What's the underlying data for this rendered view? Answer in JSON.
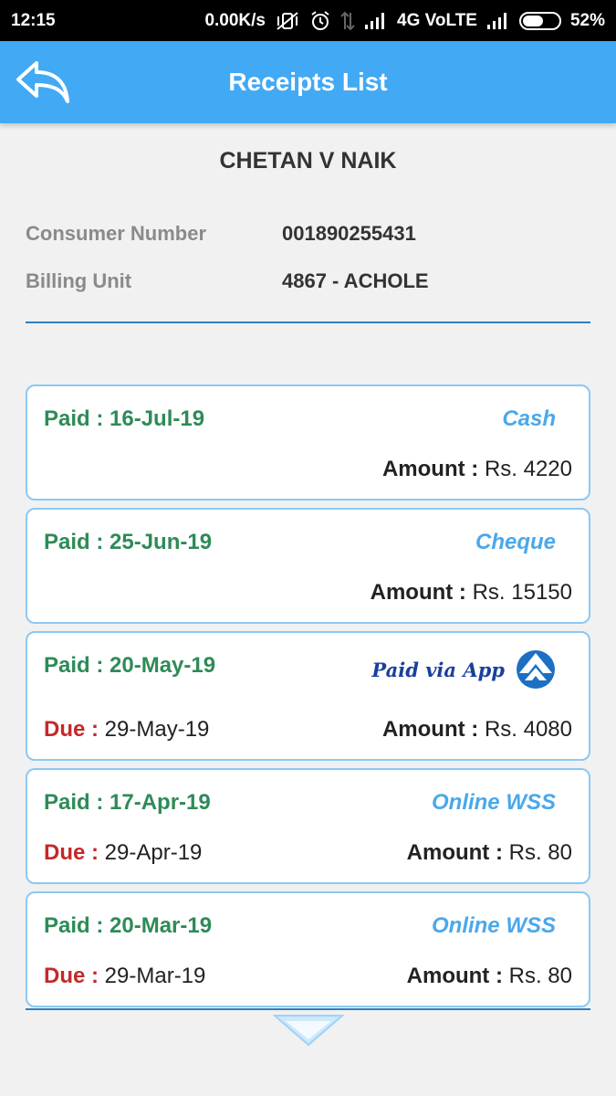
{
  "status_bar": {
    "time": "12:15",
    "net_speed": "0.00K/s",
    "network": "4G VoLTE",
    "battery": "52%",
    "battery_level": 0.52
  },
  "header": {
    "title": "Receipts List",
    "back_icon": "back-arrow-icon"
  },
  "consumer": {
    "name": "CHETAN V NAIK",
    "number_label": "Consumer Number",
    "number_value": "001890255431",
    "billing_label": "Billing Unit",
    "billing_value": "4867 - ACHOLE"
  },
  "labels": {
    "paid": "Paid :",
    "due": "Due :",
    "amount": "Amount :"
  },
  "receipts": [
    {
      "paid_date": "16-Jul-19",
      "mode": "Cash",
      "amount": "Rs. 4220"
    },
    {
      "paid_date": "25-Jun-19",
      "mode": "Cheque",
      "amount": "Rs. 15150"
    },
    {
      "paid_date": "20-May-19",
      "mode": "Paid via App",
      "due_date": "29-May-19",
      "amount": "Rs. 4080"
    },
    {
      "paid_date": "17-Apr-19",
      "mode": "Online WSS",
      "due_date": "29-Apr-19",
      "amount": "Rs. 80"
    },
    {
      "paid_date": "20-Mar-19",
      "mode": "Online WSS",
      "due_date": "29-Mar-19",
      "amount": "Rs. 80"
    }
  ],
  "colors": {
    "app_bar": "#42a9f5",
    "paid_text": "#2e8b57",
    "due_label": "#c62828",
    "mode_text": "#4aa8ea",
    "card_border": "#8cc8f3",
    "divider": "#2f7fc1"
  }
}
